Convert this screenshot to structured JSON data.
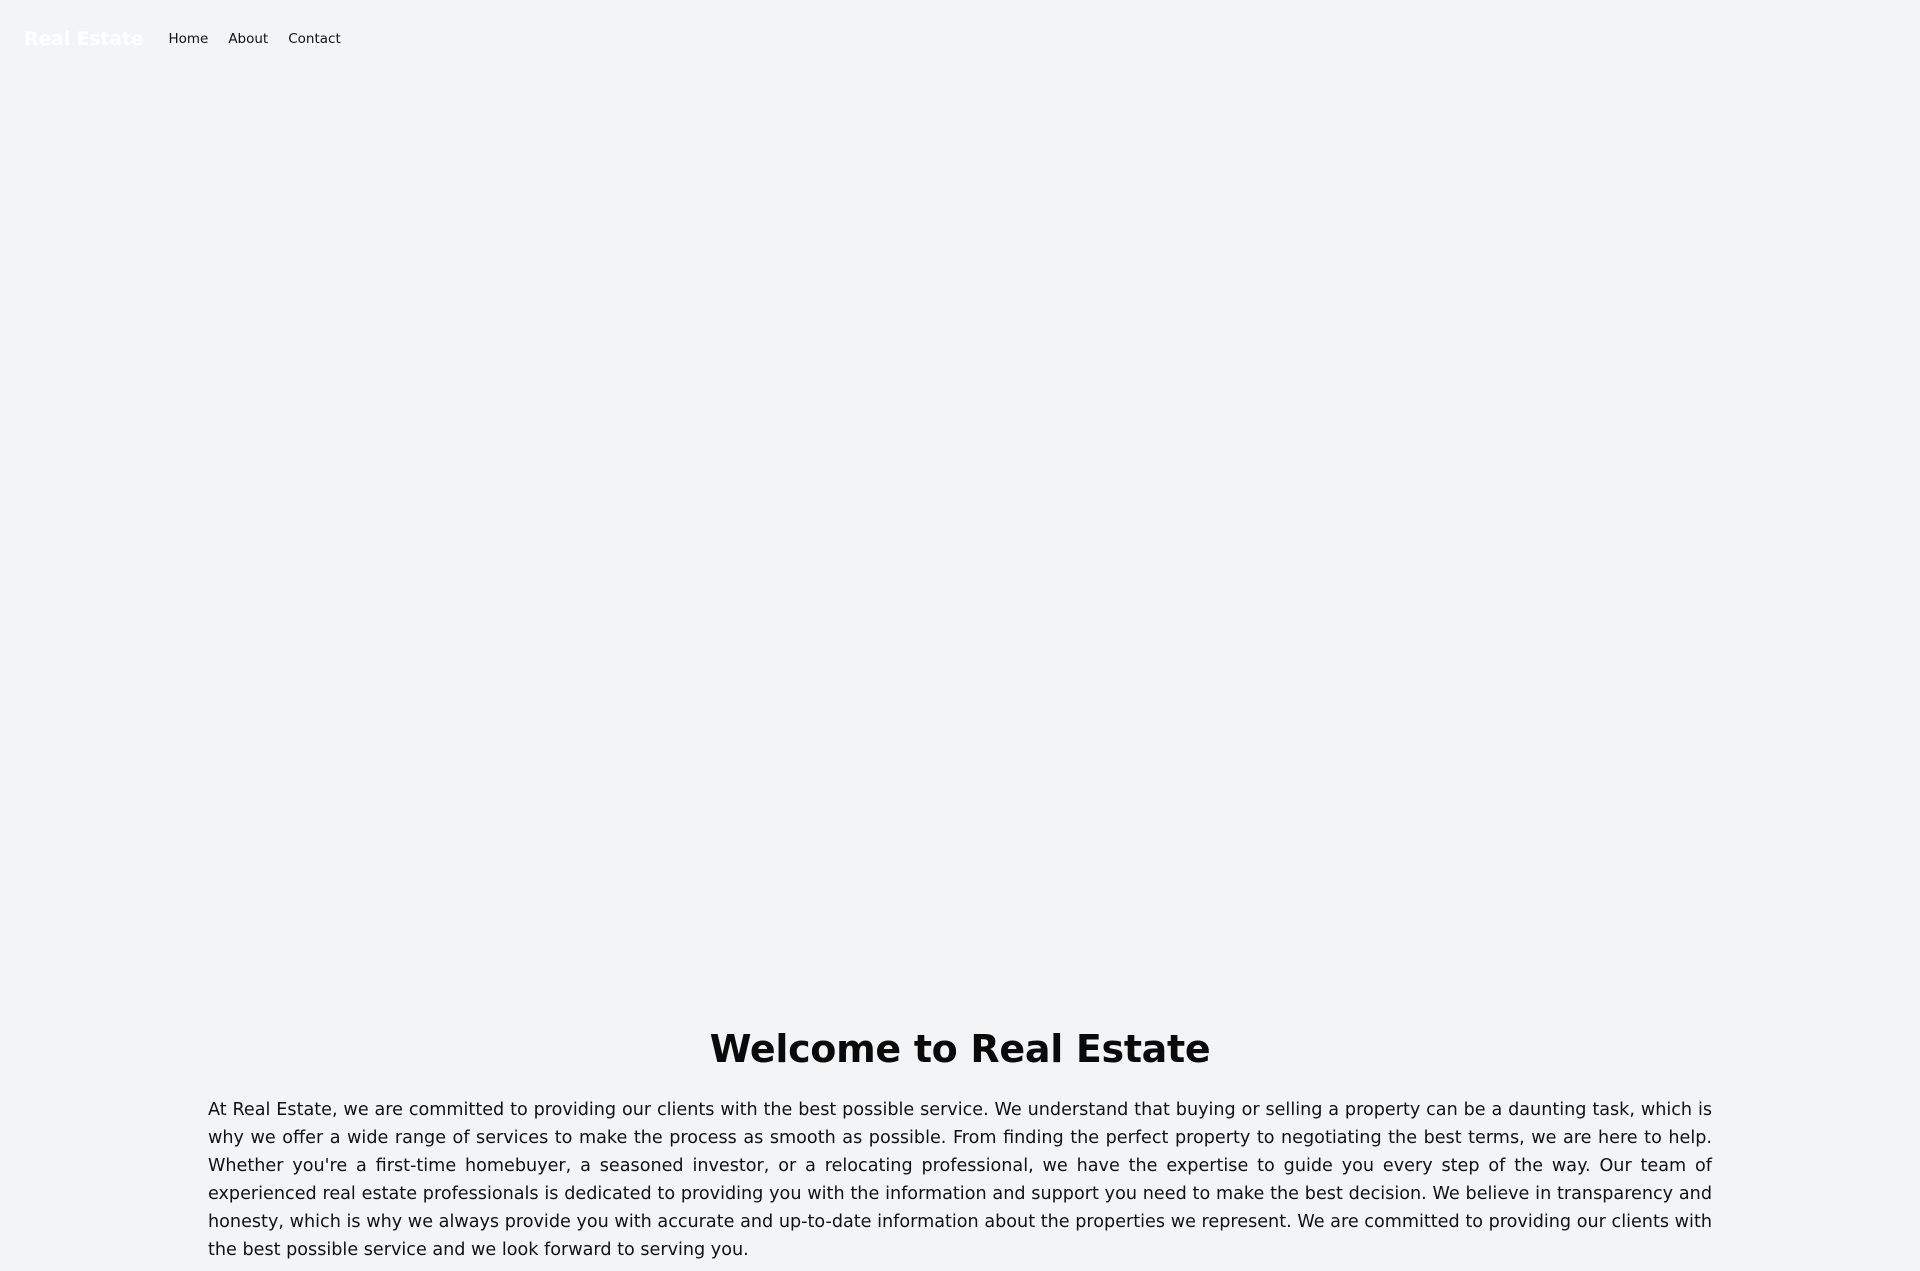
{
  "nav": {
    "brand": "Real Estate",
    "links": [
      {
        "label": "Home"
      },
      {
        "label": "About"
      },
      {
        "label": "Contact"
      }
    ]
  },
  "main": {
    "title": "Welcome to Real Estate",
    "body": "At Real Estate, we are committed to providing our clients with the best possible service. We understand that buying or selling a property can be a daunting task, which is why we offer a wide range of services to make the process as smooth as possible. From finding the perfect property to negotiating the best terms, we are here to help. Whether you're a first-time homebuyer, a seasoned investor, or a relocating professional, we have the expertise to guide you every step of the way. Our team of experienced real estate professionals is dedicated to providing you with the information and support you need to make the best decision. We believe in transparency and honesty, which is why we always provide you with accurate and up-to-date information about the properties we represent. We are committed to providing our clients with the best possible service and we look forward to serving you."
  },
  "colors": {
    "background": "#f3f4f6",
    "brand_text": "#ffffff",
    "text": "#111111"
  }
}
